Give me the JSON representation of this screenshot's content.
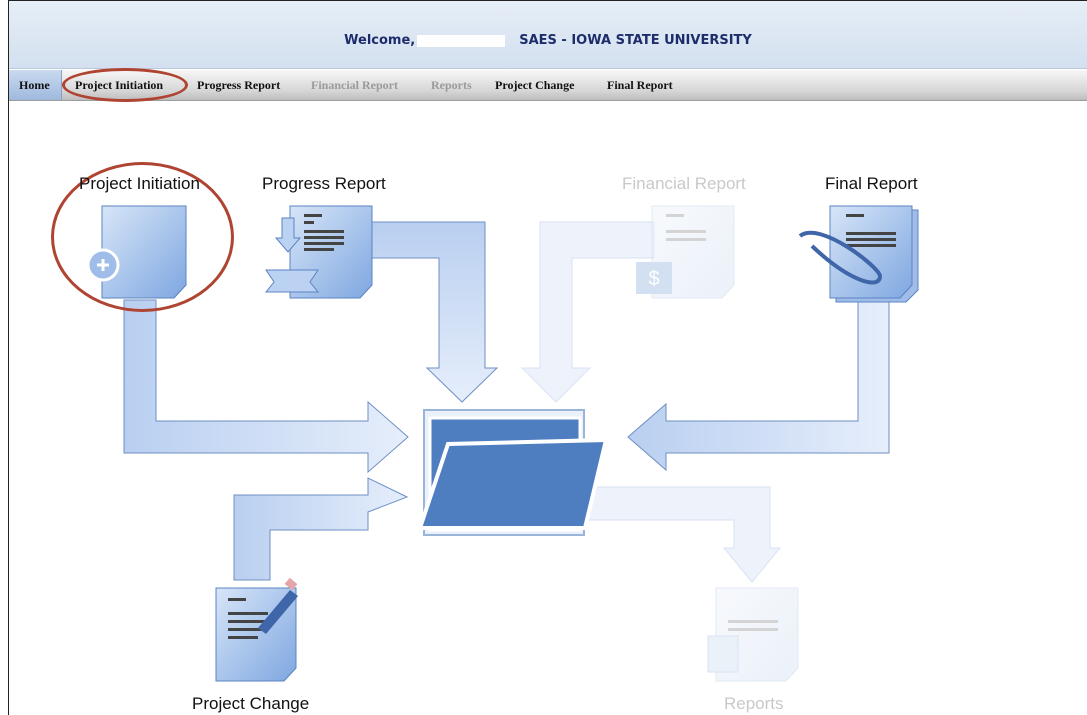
{
  "header": {
    "welcome_prefix": "Welcome,",
    "institution": "SAES - IOWA STATE UNIVERSITY"
  },
  "nav": {
    "items": [
      {
        "label": "Home",
        "enabled": true
      },
      {
        "label": "Project Initiation",
        "enabled": true
      },
      {
        "label": "Progress Report",
        "enabled": true
      },
      {
        "label": "Financial Report",
        "enabled": false
      },
      {
        "label": "Reports",
        "enabled": false
      },
      {
        "label": "Project Change",
        "enabled": true
      },
      {
        "label": "Final Report",
        "enabled": true
      }
    ]
  },
  "workflow": {
    "project_initiation": "Project Initiation",
    "progress_report": "Progress Report",
    "financial_report": "Financial Report",
    "final_report": "Final Report",
    "project_change": "Project Change",
    "reports": "Reports",
    "financial_icon_symbol": "$"
  },
  "colors": {
    "header_text": "#1d2d6b",
    "highlight_circle": "#b04432",
    "doc_blue": "#7ea7e0",
    "folder_blue": "#4f7ec0"
  }
}
